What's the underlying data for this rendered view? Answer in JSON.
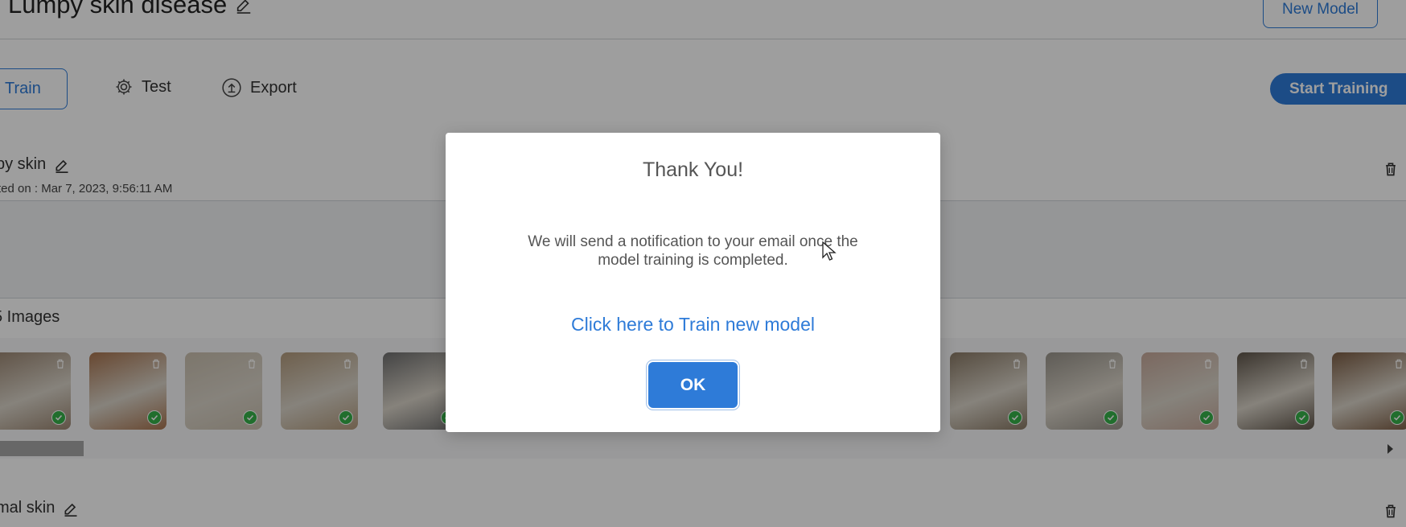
{
  "header": {
    "title": "Lumpy skin disease",
    "new_model_label": "New Model"
  },
  "tabs": [
    {
      "label": "Train"
    },
    {
      "label": "Test"
    },
    {
      "label": "Export"
    }
  ],
  "start_training_label": "Start Training",
  "class1": {
    "name": "py skin",
    "date": "ted on : Mar 7, 2023, 9:56:11 AM",
    "image_count": "5 Images"
  },
  "class2": {
    "name": "mal skin"
  },
  "modal": {
    "title": "Thank You!",
    "message_line1": "We will send a notification to your email once the",
    "message_line2": "model training is completed.",
    "link": "Click here to Train new model",
    "ok_label": "OK"
  },
  "thumbnails": [
    {
      "color": "#9b8672"
    },
    {
      "color": "#a8744f"
    },
    {
      "color": "#c9bfae"
    },
    {
      "color": "#b29a7c"
    },
    {
      "color": "#6e6e6e"
    },
    {
      "color": "#8a7a66"
    },
    {
      "color": "#99948b"
    },
    {
      "color": "#c6a89a"
    },
    {
      "color": "#5f554a"
    },
    {
      "color": "#7d5e45"
    }
  ],
  "colors": {
    "accent": "#2e7bd8",
    "status_ok": "#36b24a"
  }
}
